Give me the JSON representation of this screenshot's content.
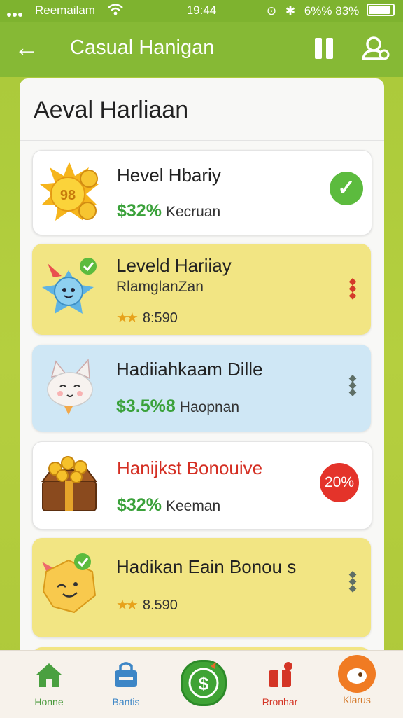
{
  "status_bar": {
    "carrier": "Reemailam",
    "time": "19:44",
    "battery": "6%% 83%",
    "icons": [
      "signal-icon",
      "wifi-icon",
      "alarm-icon",
      "bluetooth-icon",
      "battery-icon"
    ]
  },
  "app_bar": {
    "title": "Casual Hanigan",
    "icons": [
      "back-arrow-icon",
      "pause-icon",
      "user-icon"
    ]
  },
  "panel": {
    "title": "Aeval Harliaan",
    "items": [
      {
        "name": "Hevel Hbariy",
        "amount": "$32%",
        "desc": "Kecruan",
        "status": "check",
        "icon": "sun-coin-icon"
      },
      {
        "name": "Leveld Hariiay",
        "sub": "RlamglanZan",
        "stars": "★★",
        "number": "8:590",
        "status": "red-arrows",
        "icon": "star-creature-icon"
      },
      {
        "name": "Hadiiahkaam Dille",
        "amount": "$3.5%8",
        "desc": "Haopnan",
        "status": "grey-arrows",
        "icon": "cat-icon"
      },
      {
        "name": "Hanijkst Bonouive",
        "amount": "$32%",
        "desc": "Keeman",
        "badge": "20%",
        "icon": "treasure-chest-icon"
      },
      {
        "name": "Hadikan Eain Bonou s",
        "stars": "★★",
        "number": "8.590",
        "status": "grey-arrows",
        "icon": "smiley-badge-icon"
      }
    ]
  },
  "bottom_nav": {
    "items": [
      {
        "label": "Honne",
        "icon": "home-icon"
      },
      {
        "label": "Bantis",
        "icon": "bag-icon"
      },
      {
        "label": "",
        "icon": "dollar-badge-icon"
      },
      {
        "label": "Rronhar",
        "icon": "gift-icon"
      },
      {
        "label": "Klarus",
        "icon": "orange-face-icon"
      }
    ]
  },
  "colors": {
    "brand_green": "#86b935",
    "background": "#b5cf3f",
    "check_green": "#5cbb3e",
    "badge_red": "#e4332a",
    "amount_green": "#3aa13a"
  }
}
